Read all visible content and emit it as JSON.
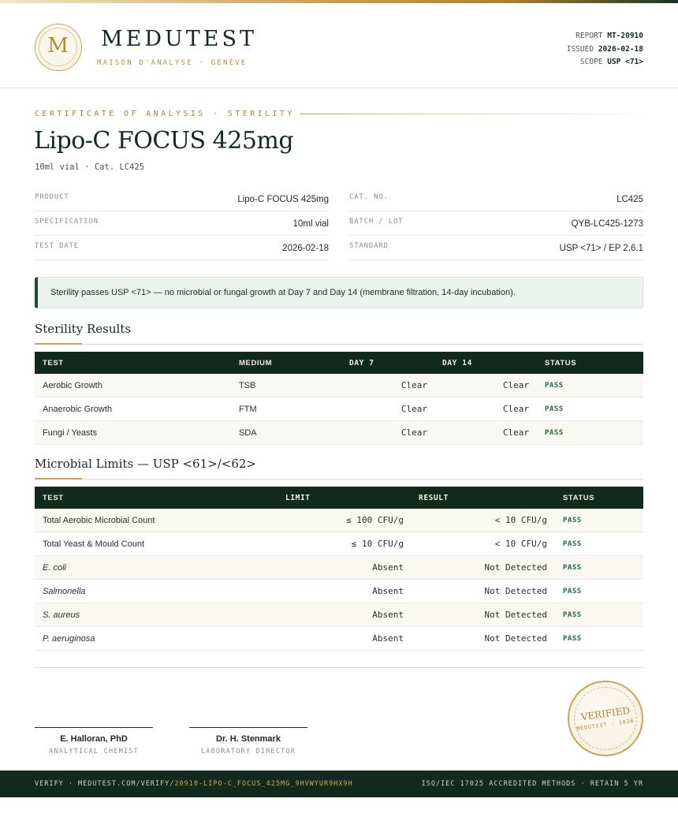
{
  "brand": {
    "logo_letter": "M",
    "name": "MEDUTEST",
    "tagline": "MAISON D'ANALYSE · GENÈVE"
  },
  "meta": {
    "report_label": "REPORT",
    "report_value": "MT-20910",
    "issued_label": "ISSUED",
    "issued_value": "2026-02-18",
    "scope_label": "SCOPE",
    "scope_value": "USP <71>"
  },
  "doc": {
    "kicker": "CERTIFICATE OF ANALYSIS · STERILITY",
    "title": "Lipo-C FOCUS 425mg",
    "subtitle": "10ml vial  ·  Cat. LC425"
  },
  "specs": {
    "left": [
      {
        "label": "PRODUCT",
        "value": "Lipo-C FOCUS 425mg"
      },
      {
        "label": "SPECIFICATION",
        "value": "10ml vial"
      },
      {
        "label": "TEST DATE",
        "value": "2026-02-18"
      }
    ],
    "right": [
      {
        "label": "CAT. NO.",
        "value": "LC425"
      },
      {
        "label": "BATCH / LOT",
        "value": "QYB-LC425-1273"
      },
      {
        "label": "STANDARD",
        "value": "USP <71> / EP 2.6.1"
      }
    ]
  },
  "banner": {
    "text": "Sterility passes USP <71> — no microbial or fungal growth at Day 7 and Day 14 (membrane filtration, 14-day incubation)."
  },
  "sterility": {
    "title": "Sterility Results",
    "headers": [
      "TEST",
      "MEDIUM",
      "DAY 7",
      "DAY 14",
      "STATUS"
    ],
    "rows": [
      {
        "test": "Aerobic Growth",
        "medium": "TSB",
        "day7": "Clear",
        "day14": "Clear",
        "status": "PASS"
      },
      {
        "test": "Anaerobic Growth",
        "medium": "FTM",
        "day7": "Clear",
        "day14": "Clear",
        "status": "PASS"
      },
      {
        "test": "Fungi / Yeasts",
        "medium": "SDA",
        "day7": "Clear",
        "day14": "Clear",
        "status": "PASS"
      }
    ]
  },
  "microbial": {
    "title": "Microbial Limits — USP <61>/<62>",
    "headers": [
      "TEST",
      "LIMIT",
      "RESULT",
      "STATUS"
    ],
    "rows": [
      {
        "test": "Total Aerobic Microbial Count",
        "limit": "≤ 100 CFU/g",
        "result": "< 10 CFU/g",
        "status": "PASS"
      },
      {
        "test": "Total Yeast & Mould Count",
        "limit": "≤ 10 CFU/g",
        "result": "< 10 CFU/g",
        "status": "PASS"
      },
      {
        "test": "E. coli",
        "limit": "Absent",
        "result": "Not Detected",
        "status": "PASS"
      },
      {
        "test": "Salmonella",
        "limit": "Absent",
        "result": "Not Detected",
        "status": "PASS"
      },
      {
        "test": "S. aureus",
        "limit": "Absent",
        "result": "Not Detected",
        "status": "PASS"
      },
      {
        "test": "P. aeruginosa",
        "limit": "Absent",
        "result": "Not Detected",
        "status": "PASS"
      }
    ]
  },
  "signatures": [
    {
      "name": "E. Halloran, PhD",
      "role": "ANALYTICAL CHEMIST"
    },
    {
      "name": "Dr. H. Stenmark",
      "role": "LABORATORY DIRECTOR"
    }
  ],
  "seal": {
    "line1": "VERIFIED",
    "line2": "MEDUTEST · 2026"
  },
  "footer": {
    "verify_prefix": "VERIFY · MEDUTEST.COM/VERIFY/",
    "verify_code": "20910-LIPO-C_FOCUS_425MG_9HVWYUR9HX9H",
    "right": "ISO/IEC 17025 ACCREDITED METHODS · RETAIN 5 YR"
  }
}
